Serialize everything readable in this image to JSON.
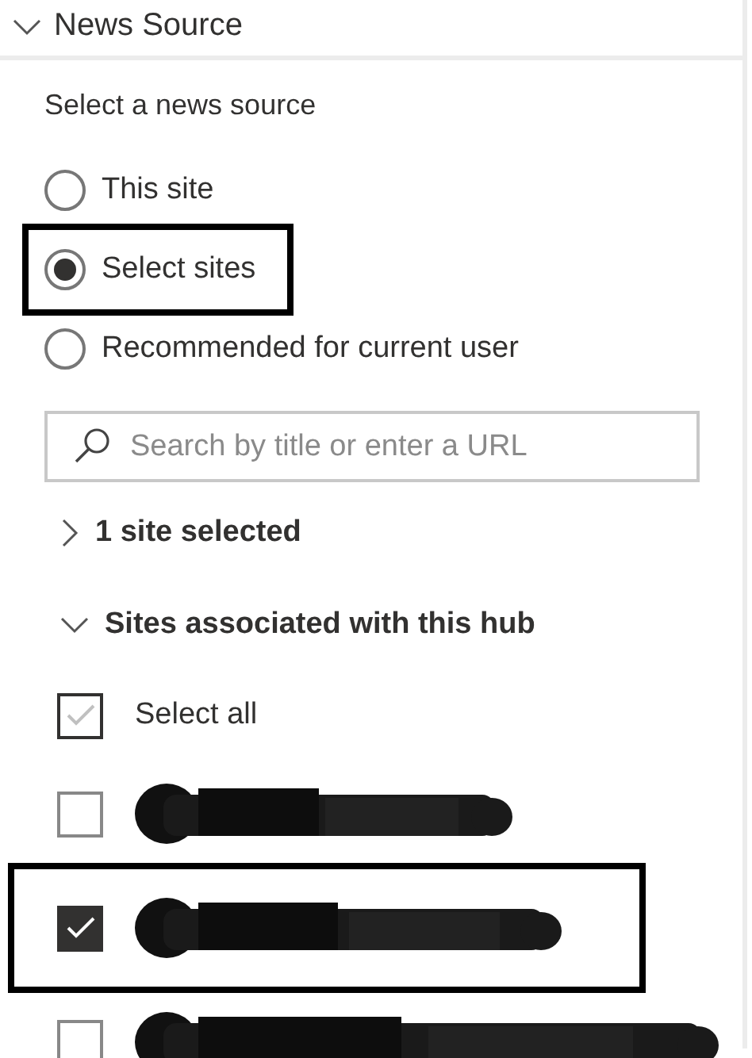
{
  "section": {
    "title": "News Source",
    "expanded": true
  },
  "source_group": {
    "label": "Select a news source",
    "options": [
      {
        "label": "This site",
        "selected": false,
        "highlighted": false
      },
      {
        "label": "Select sites",
        "selected": true,
        "highlighted": true
      },
      {
        "label": "Recommended for current user",
        "selected": false,
        "highlighted": false
      }
    ]
  },
  "search": {
    "placeholder": "Search by title or enter a URL"
  },
  "groups": [
    {
      "label": "1 site selected",
      "expanded": false
    },
    {
      "label": "Sites associated with this hub",
      "expanded": true
    }
  ],
  "select_all": {
    "label": "Select all",
    "partially_checked": true
  },
  "sites": [
    {
      "checked": false,
      "highlighted": false
    },
    {
      "checked": true,
      "highlighted": true
    },
    {
      "checked": false,
      "highlighted": false
    }
  ]
}
